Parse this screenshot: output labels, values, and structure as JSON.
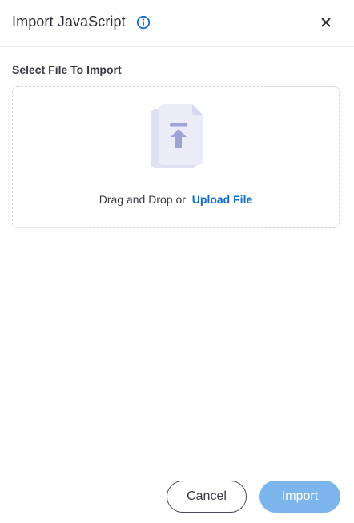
{
  "dialog": {
    "title": "Import JavaScript",
    "info_icon": "info-circle-icon",
    "close_icon": "close-icon",
    "accent_color": "#0e6ec8"
  },
  "section": {
    "label": "Select File To Import"
  },
  "dropzone": {
    "illustration_icon": "file-upload-icon",
    "prompt": "Drag and Drop or",
    "upload_link": "Upload File"
  },
  "footer": {
    "cancel_label": "Cancel",
    "import_label": "Import",
    "import_color": "#7cb5ec"
  }
}
